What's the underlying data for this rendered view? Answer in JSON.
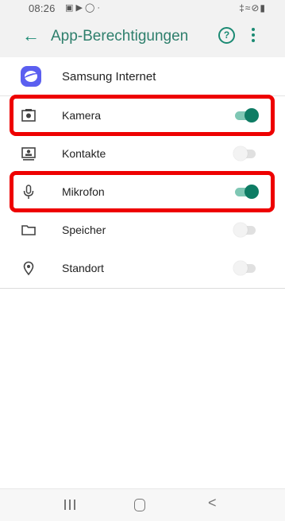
{
  "status": {
    "time": "08:26",
    "left_icons": "▣ ▶ ◯ ·",
    "right_icons": "‡≈⊘▮"
  },
  "appbar": {
    "back_icon": "arrow-left-icon",
    "title": "App-Berechtigungen",
    "help_glyph": "?"
  },
  "app": {
    "name": "Samsung Internet",
    "icon": "samsung-internet-icon",
    "icon_color": "#5b5ff0"
  },
  "permissions": [
    {
      "label": "Kamera",
      "icon": "camera-icon",
      "enabled": true
    },
    {
      "label": "Kontakte",
      "icon": "contacts-icon",
      "enabled": false
    },
    {
      "label": "Mikrofon",
      "icon": "microphone-icon",
      "enabled": true
    },
    {
      "label": "Speicher",
      "icon": "folder-icon",
      "enabled": false
    },
    {
      "label": "Standort",
      "icon": "location-icon",
      "enabled": false
    }
  ],
  "highlighted": [
    "Kamera",
    "Mikrofon"
  ],
  "navbar": {
    "back_glyph": "<"
  },
  "colors": {
    "accent": "#1b8a73",
    "toggle_on": "#0e7c64",
    "highlight": "#ee0000"
  }
}
